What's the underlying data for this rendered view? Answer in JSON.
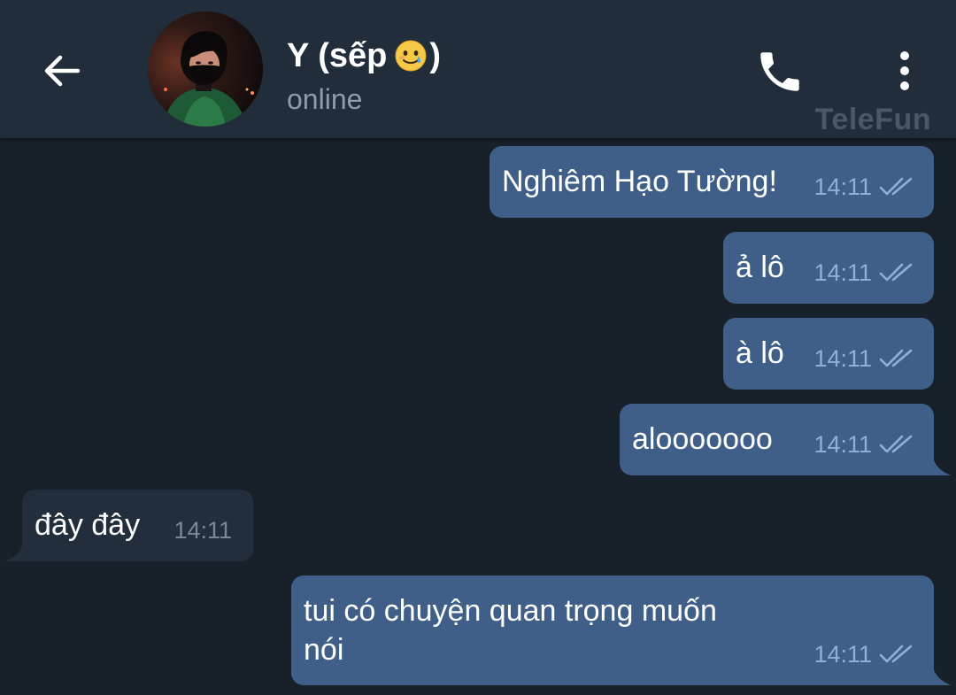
{
  "header": {
    "back_icon": "arrow-left-icon",
    "name_prefix": "Y (sếp",
    "name_suffix": ")",
    "emoji": "smiling-face-with-tear",
    "status": "online",
    "call_icon": "phone-icon",
    "menu_icon": "more-vertical-icon",
    "watermark": "TeleFun"
  },
  "colors": {
    "header_bg": "#212d3b",
    "chat_bg": "#182029",
    "outgoing_bubble": "#3f5f88",
    "incoming_bubble": "#232e3c",
    "outgoing_time": "#8fb0d6",
    "incoming_time": "#7a8896"
  },
  "messages": [
    {
      "direction": "out",
      "text": "Nghiêm Hạo Tường!",
      "time": "14:11",
      "status": "read"
    },
    {
      "direction": "out",
      "text": "ả lô",
      "time": "14:11",
      "status": "read"
    },
    {
      "direction": "out",
      "text": "à lô",
      "time": "14:11",
      "status": "read"
    },
    {
      "direction": "out",
      "text": "alooooooo",
      "time": "14:11",
      "status": "read"
    },
    {
      "direction": "in",
      "text": "đây đây",
      "time": "14:11"
    },
    {
      "direction": "out",
      "text_line1": "tui có chuyện quan trọng muốn",
      "text_line2": "nói",
      "time": "14:11",
      "status": "read"
    }
  ]
}
